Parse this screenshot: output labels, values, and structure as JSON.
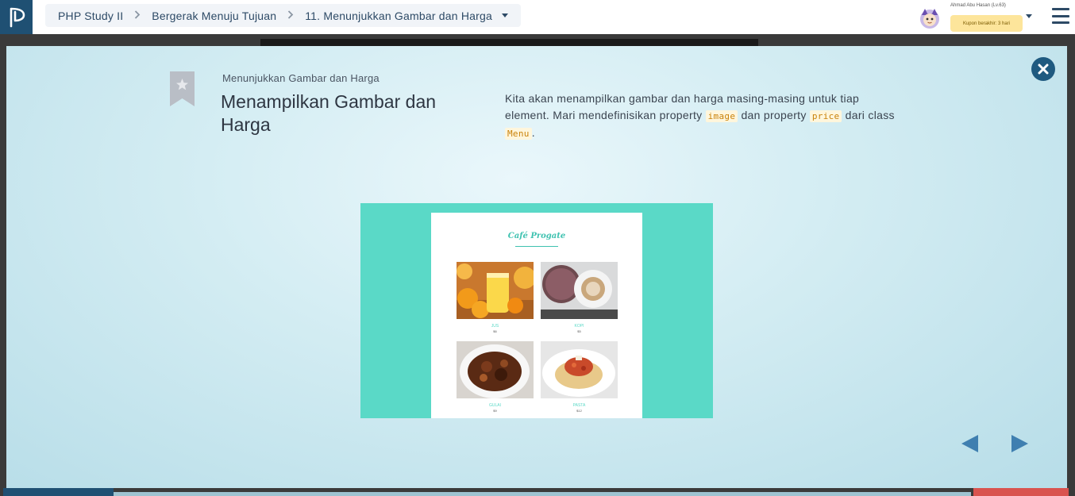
{
  "breadcrumb": {
    "items": [
      "PHP Study II",
      "Bergerak Menuju Tujuan",
      "11. Menunjukkan Gambar dan Harga"
    ]
  },
  "user": {
    "name": "Ahmad Abu Hasan (Lv.63)",
    "coupon": "Kupon berakhir: 3 hari"
  },
  "slide": {
    "subtitle": "Menunjukkan Gambar dan Harga",
    "title": "Menampilkan Gambar dan Harga",
    "desc_part1": "Kita akan menampilkan gambar dan harga masing-masing untuk tiap element. Mari mendefinisikan property ",
    "code1": "image",
    "desc_part2": " dan property ",
    "code2": "price",
    "desc_part3": " dari class ",
    "code3": "Menu",
    "desc_part4": "."
  },
  "preview": {
    "cafe_name": "Café Progate",
    "items": [
      {
        "label": "JUS",
        "price": "$6"
      },
      {
        "label": "KOPI",
        "price": "$5"
      },
      {
        "label": "GULAI",
        "price": "$9"
      },
      {
        "label": "PASTA",
        "price": "$12"
      }
    ]
  },
  "colors": {
    "brand": "#1f5073",
    "accent": "#5ad9c7",
    "coupon": "#fde59b"
  }
}
